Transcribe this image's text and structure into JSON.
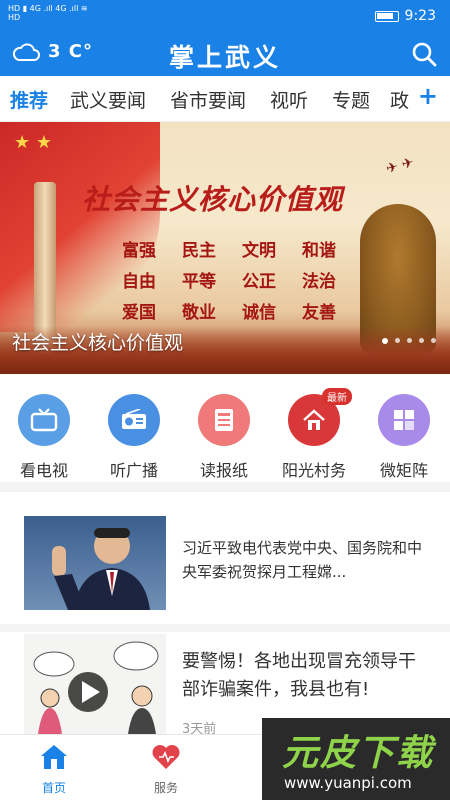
{
  "status_bar": {
    "left_top": "HD ▮ 4G .ıll  4G .ıll  ≋",
    "left_bottom": "HD",
    "time": "9:23"
  },
  "header": {
    "temperature": "3 C°",
    "title": "掌上武义",
    "icons": {
      "weather": "cloud-icon",
      "search": "search-icon"
    }
  },
  "tabs": {
    "items": [
      "推荐",
      "武义要闻",
      "省市要闻",
      "视听",
      "专题",
      "政"
    ],
    "add_label": "+",
    "active_color": "#1a82e6"
  },
  "banner": {
    "headline": "社会主义核心价值观",
    "values": [
      "富强",
      "民主",
      "文明",
      "和谐",
      "自由",
      "平等",
      "公正",
      "法治",
      "爱国",
      "敬业",
      "诚信",
      "友善"
    ],
    "caption": "社会主义核心价值观",
    "slide_count": 5,
    "active_slide": 1
  },
  "quick_links": [
    {
      "label": "看电视",
      "icon": "tv-icon",
      "color": "#5a9fe6"
    },
    {
      "label": "听广播",
      "icon": "radio-icon",
      "color": "#4a90e2"
    },
    {
      "label": "读报纸",
      "icon": "newspaper-icon",
      "color": "#f07a7a"
    },
    {
      "label": "阳光村务",
      "icon": "house-icon",
      "color": "#d9383a",
      "badge": "最新"
    },
    {
      "label": "微矩阵",
      "icon": "grid-icon",
      "color": "#a88be8"
    }
  ],
  "news": [
    {
      "title": "习近平致电代表党中央、国务院和中央军委祝贺探月工程嫦..."
    },
    {
      "title": "要警惕！各地出现冒充领导干部诈骗案件，我县也有!",
      "time": "3天前"
    }
  ],
  "bottom_nav": [
    {
      "label": "首页",
      "icon": "home-icon",
      "active": true
    },
    {
      "label": "服务",
      "icon": "heart-icon",
      "active": false
    }
  ],
  "watermark": {
    "title": "元皮下载",
    "url": "www.yuanpi.com"
  },
  "colors": {
    "brand": "#1a82e6",
    "text": "#333333",
    "muted": "#999999"
  }
}
